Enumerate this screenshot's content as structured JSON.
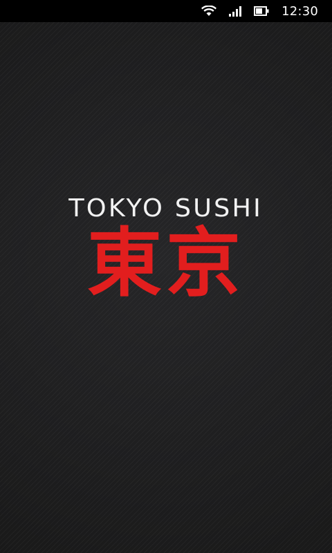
{
  "status_bar": {
    "time": "12:30",
    "icons": [
      "wifi-icon",
      "signal-icon",
      "battery-icon"
    ]
  },
  "splash": {
    "brand_name": "TOKYO SUSHI",
    "brand_kanji": "東京"
  },
  "colors": {
    "background": "#1f1f20",
    "brand_text": "#f2f2f2",
    "kanji": "#e21e1e",
    "status_bar": "#000000"
  }
}
